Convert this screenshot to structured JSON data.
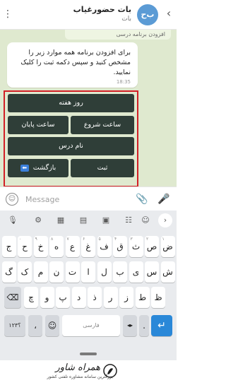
{
  "header": {
    "back_icon": "‹",
    "avatar_text": "ب‌ح",
    "title": "بات حضورغیاب",
    "subtitle": "بات",
    "menu_icon": "⋮"
  },
  "chat": {
    "top_message_fragment": "افزودن برنامه درسی",
    "message": {
      "text": "برای افزودن برنامه همه موارد زیر را مشخص کنید و سپس دکمه ثبت را کلیک نمایید.",
      "time": "18:35"
    },
    "reply_keyboard": {
      "day_of_week": "روز هفته",
      "start_time": "ساعت شروع",
      "end_time": "ساعت پایان",
      "lesson_name": "نام درس",
      "submit": "ثبت",
      "back": "بازگشت"
    }
  },
  "composer": {
    "placeholder": "Message",
    "emoji_icon": "smiley-icon",
    "attach_icon": "paperclip-icon",
    "mic_icon": "microphone-icon"
  },
  "keyboard": {
    "rows": [
      [
        "ض",
        "ص",
        "ث",
        "ق",
        "ف",
        "غ",
        "ع",
        "ه",
        "خ",
        "ح",
        "ج"
      ],
      [
        "ش",
        "س",
        "ی",
        "ب",
        "ل",
        "ا",
        "ت",
        "ن",
        "م",
        "ک",
        "گ"
      ],
      [
        "ظ",
        "ط",
        "ز",
        "ر",
        "ذ",
        "د",
        "پ",
        "و",
        "چ"
      ]
    ],
    "row_hints": [
      [
        "۱",
        "۲",
        "۳",
        "۴",
        "۵",
        "۶",
        "۷",
        "۸",
        "۹",
        "۰",
        ""
      ],
      [
        "",
        "",
        "",
        "",
        "",
        "",
        "",
        "",
        "",
        "",
        ""
      ],
      [
        "",
        "",
        "",
        "",
        "",
        "",
        "",
        "",
        ""
      ]
    ],
    "symbols_label": "؟۱۲۳",
    "comma_label": "،",
    "space_label": "فارسی",
    "period_label": ".",
    "backspace_icon": "⌫",
    "enter_icon": "↵"
  },
  "brand": {
    "name": "همراه شاور",
    "tagline": "بزرگترین سامانه مشاوره تلفنی کشور"
  },
  "colors": {
    "chat_bg": "#dfe9cf",
    "keyboard_button": "#2f3e38",
    "highlight_border": "#d21f26",
    "enter_key": "#2a88d8"
  }
}
